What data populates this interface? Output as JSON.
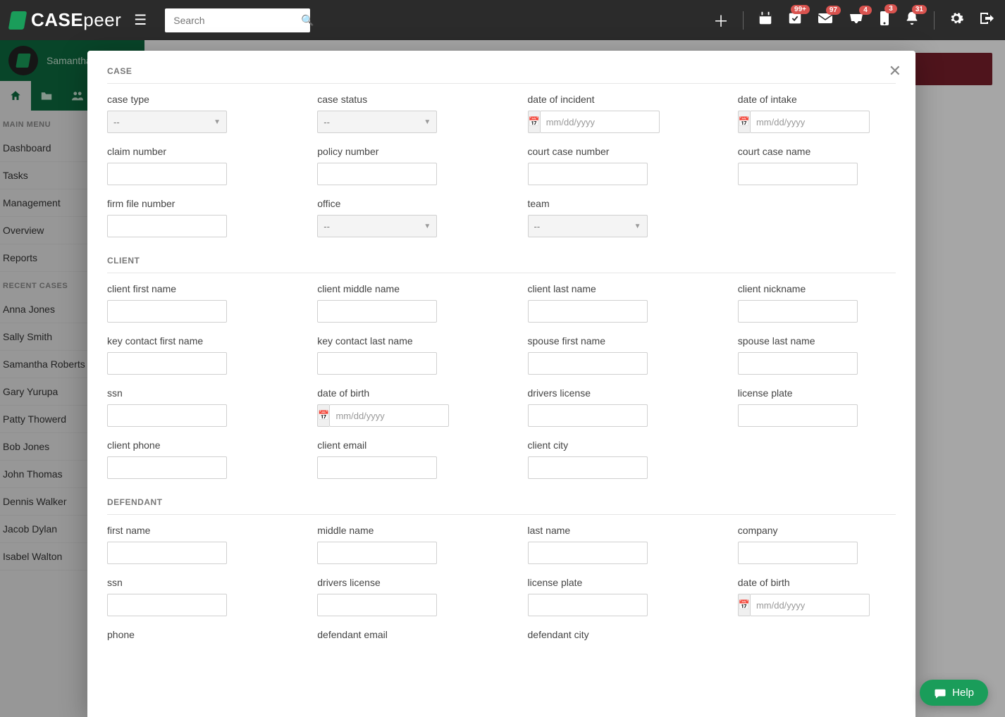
{
  "brand": {
    "part1": "CASE",
    "part2": "peer"
  },
  "search": {
    "placeholder": "Search"
  },
  "badges": {
    "checkmark": "99+",
    "envelope": "97",
    "inbox": "4",
    "mobile": "3",
    "bell": "31"
  },
  "profile": {
    "name": "Samantha"
  },
  "sidebar": {
    "main_menu_heading": "MAIN MENU",
    "main_menu": [
      "Dashboard",
      "Tasks",
      "Management",
      "Overview",
      "Reports"
    ],
    "recent_heading": "RECENT CASES",
    "recent": [
      "Anna Jones",
      "Sally Smith",
      "Samantha Roberts",
      "Gary Yurupa",
      "Patty Thowerd",
      "Bob Jones",
      "John Thomas",
      "Dennis Walker",
      "Jacob Dylan",
      "Isabel Walton"
    ]
  },
  "modal": {
    "sections": {
      "case": {
        "title": "CASE",
        "fields": {
          "case_type": "case type",
          "case_status": "case status",
          "date_of_incident": "date of incident",
          "date_of_intake": "date of intake",
          "claim_number": "claim number",
          "policy_number": "policy number",
          "court_case_number": "court case number",
          "court_case_name": "court case name",
          "firm_file_number": "firm file number",
          "office": "office",
          "team": "team"
        }
      },
      "client": {
        "title": "CLIENT",
        "fields": {
          "client_first_name": "client first name",
          "client_middle_name": "client middle name",
          "client_last_name": "client last name",
          "client_nickname": "client nickname",
          "key_contact_first_name": "key contact first name",
          "key_contact_last_name": "key contact last name",
          "spouse_first_name": "spouse first name",
          "spouse_last_name": "spouse last name",
          "ssn": "ssn",
          "date_of_birth": "date of birth",
          "drivers_license": "drivers license",
          "license_plate": "license plate",
          "client_phone": "client phone",
          "client_email": "client email",
          "client_city": "client city"
        }
      },
      "defendant": {
        "title": "DEFENDANT",
        "fields": {
          "first_name": "first name",
          "middle_name": "middle name",
          "last_name": "last name",
          "company": "company",
          "ssn": "ssn",
          "drivers_license": "drivers license",
          "license_plate": "license plate",
          "date_of_birth": "date of birth",
          "phone": "phone",
          "defendant_email": "defendant email",
          "defendant_city": "defendant city"
        }
      }
    },
    "select_placeholder": "--",
    "date_placeholder": "mm/dd/yyyy"
  },
  "help": {
    "label": "Help"
  }
}
